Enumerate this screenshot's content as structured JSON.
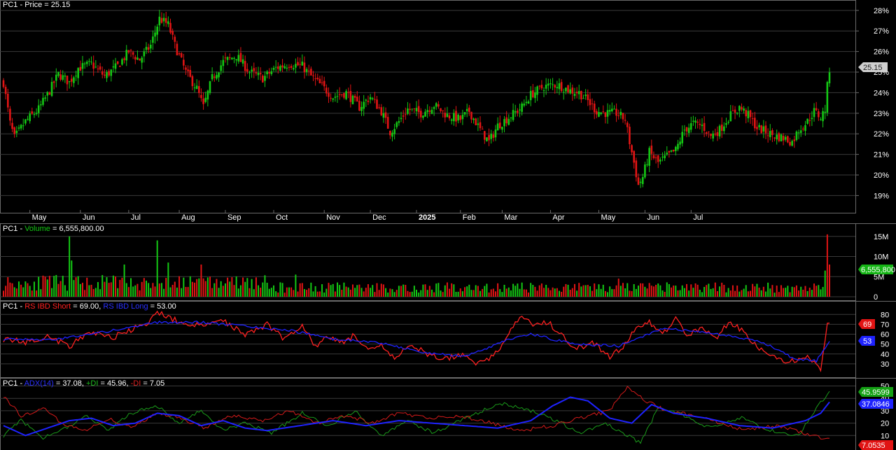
{
  "colors": {
    "up": "#14c814",
    "down": "#e11414",
    "grid": "#3a3a3a",
    "border": "#6a6a6a",
    "text": "#ffffff",
    "rs_short": "#ff2020",
    "rs_long": "#1e22ff",
    "adx": "#1e22ff",
    "plus_di": "#1a9a1a",
    "minus_di": "#d41a1a"
  },
  "price_panel": {
    "symbol": "PC1",
    "title_label": "Price = 25.15",
    "last_price": "25.15",
    "y_tick_labels": [
      "28%",
      "27%",
      "26%",
      "25%",
      "24%",
      "23%",
      "22%",
      "21%",
      "20%",
      "19%"
    ],
    "x_tick_labels": [
      "May",
      "Jun",
      "Jul",
      "Aug",
      "Sep",
      "Oct",
      "Nov",
      "Dec",
      "2025",
      "Feb",
      "Mar",
      "Apr",
      "May",
      "Jun",
      "Jul"
    ]
  },
  "volume_panel": {
    "symbol": "PC1",
    "name": "Volume",
    "value_text": "6,555,800.00",
    "last_value_label": "6,555,800",
    "y_tick_labels": [
      "15M",
      "10M",
      "5M",
      "0"
    ]
  },
  "rs_panel": {
    "symbol": "PC1",
    "short_label": "RS IBD Short",
    "short_value": "69.00",
    "long_label": "RS IBD Long",
    "long_value": "53.00",
    "short_last": "69",
    "long_last": "53",
    "y_tick_labels": [
      "80",
      "70",
      "60",
      "50",
      "40",
      "30"
    ]
  },
  "adx_panel": {
    "symbol": "PC1",
    "adx_label": "ADX(14)",
    "adx_value": "37.08",
    "plus_label": "+DI",
    "plus_value": "45.96",
    "minus_label": "-DI",
    "minus_value": "7.05",
    "plus_last": "45.9599",
    "adx_last": "37.0846",
    "minus_last": "7.0535",
    "y_tick_labels": [
      "50",
      "40",
      "30",
      "20",
      "10"
    ]
  },
  "chart_data": [
    {
      "type": "candlestick",
      "title": "PC1 - Price = 25.15",
      "ylim": [
        18.3,
        28.3
      ],
      "x_tick_labels": [
        "May",
        "Jun",
        "Jul",
        "Aug",
        "Sep",
        "Oct",
        "Nov",
        "Dec",
        "2025",
        "Feb",
        "Mar",
        "Apr",
        "May",
        "Jun",
        "Jul"
      ],
      "close_path": [
        [
          0,
          24.5
        ],
        [
          3,
          22.5
        ],
        [
          5,
          21.8
        ],
        [
          10,
          22.6
        ],
        [
          16,
          23.2
        ],
        [
          20,
          23.9
        ],
        [
          25,
          24.9
        ],
        [
          30,
          24.5
        ],
        [
          34,
          25.2
        ],
        [
          40,
          25.4
        ],
        [
          46,
          24.8
        ],
        [
          52,
          25.3
        ],
        [
          57,
          26.0
        ],
        [
          62,
          25.6
        ],
        [
          67,
          26.3
        ],
        [
          71,
          27.6
        ],
        [
          75,
          27.3
        ],
        [
          78,
          26.3
        ],
        [
          83,
          25.0
        ],
        [
          88,
          24.2
        ],
        [
          91,
          23.3
        ],
        [
          95,
          24.7
        ],
        [
          100,
          25.5
        ],
        [
          106,
          25.8
        ],
        [
          112,
          25.0
        ],
        [
          118,
          24.7
        ],
        [
          124,
          25.2
        ],
        [
          130,
          25.4
        ],
        [
          136,
          25.3
        ],
        [
          140,
          24.8
        ],
        [
          146,
          24.2
        ],
        [
          150,
          23.8
        ],
        [
          156,
          24.0
        ],
        [
          162,
          23.3
        ],
        [
          167,
          23.8
        ],
        [
          172,
          23.1
        ],
        [
          176,
          22.1
        ],
        [
          180,
          22.6
        ],
        [
          184,
          23.2
        ],
        [
          190,
          23.0
        ],
        [
          196,
          23.4
        ],
        [
          202,
          22.9
        ],
        [
          208,
          22.7
        ],
        [
          212,
          23.1
        ],
        [
          217,
          22.2
        ],
        [
          221,
          21.6
        ],
        [
          225,
          22.4
        ],
        [
          230,
          22.8
        ],
        [
          236,
          23.3
        ],
        [
          240,
          23.9
        ],
        [
          246,
          24.3
        ],
        [
          252,
          24.4
        ],
        [
          258,
          24.1
        ],
        [
          262,
          24.0
        ],
        [
          266,
          23.6
        ],
        [
          270,
          23.1
        ],
        [
          275,
          23.0
        ],
        [
          279,
          23.0
        ],
        [
          283,
          22.7
        ],
        [
          285,
          21.6
        ],
        [
          287,
          20.6
        ],
        [
          289,
          19.5
        ],
        [
          291,
          19.9
        ],
        [
          294,
          21.1
        ],
        [
          298,
          20.6
        ],
        [
          302,
          20.9
        ],
        [
          306,
          21.2
        ],
        [
          310,
          22.2
        ],
        [
          314,
          22.5
        ],
        [
          318,
          22.4
        ],
        [
          322,
          21.9
        ],
        [
          326,
          22.2
        ],
        [
          330,
          22.8
        ],
        [
          335,
          23.3
        ],
        [
          339,
          22.9
        ],
        [
          343,
          22.3
        ],
        [
          347,
          22.1
        ],
        [
          351,
          21.9
        ],
        [
          355,
          21.8
        ],
        [
          359,
          21.6
        ],
        [
          362,
          22.2
        ],
        [
          366,
          22.6
        ],
        [
          369,
          23.1
        ],
        [
          372,
          22.8
        ],
        [
          374,
          23.2
        ],
        [
          375,
          24.3
        ],
        [
          376,
          25.15
        ]
      ]
    },
    {
      "type": "bar",
      "title": "PC1 - Volume = 6,555,800.00",
      "ylim": [
        0,
        16000000
      ],
      "typical_volume": 2000000,
      "spikes": [
        [
          30,
          15000000
        ],
        [
          31,
          9000000
        ],
        [
          70,
          14000000
        ],
        [
          55,
          8000000
        ],
        [
          75,
          8500000
        ],
        [
          90,
          8000000
        ],
        [
          133,
          5500000
        ],
        [
          280,
          4500000
        ],
        [
          375,
          15500000
        ],
        [
          376,
          8000000
        ],
        [
          374,
          6500000
        ]
      ]
    },
    {
      "type": "line",
      "title": "PC1 - RS IBD Short = 69.00, RS IBD Long = 53.00",
      "ylim": [
        20,
        88
      ],
      "series": [
        {
          "name": "RS IBD Short",
          "path": [
            [
              0,
              55
            ],
            [
              10,
              52
            ],
            [
              20,
              58
            ],
            [
              30,
              48
            ],
            [
              40,
              62
            ],
            [
              50,
              57
            ],
            [
              60,
              66
            ],
            [
              66,
              70
            ],
            [
              70,
              83
            ],
            [
              80,
              72
            ],
            [
              90,
              68
            ],
            [
              100,
              74
            ],
            [
              110,
              60
            ],
            [
              120,
              70
            ],
            [
              128,
              55
            ],
            [
              136,
              70
            ],
            [
              142,
              48
            ],
            [
              148,
              57
            ],
            [
              155,
              52
            ],
            [
              160,
              60
            ],
            [
              166,
              42
            ],
            [
              172,
              48
            ],
            [
              178,
              35
            ],
            [
              186,
              50
            ],
            [
              194,
              38
            ],
            [
              200,
              35
            ],
            [
              210,
              40
            ],
            [
              216,
              30
            ],
            [
              224,
              40
            ],
            [
              230,
              62
            ],
            [
              236,
              78
            ],
            [
              242,
              68
            ],
            [
              248,
              72
            ],
            [
              254,
              60
            ],
            [
              260,
              44
            ],
            [
              268,
              52
            ],
            [
              276,
              36
            ],
            [
              282,
              48
            ],
            [
              288,
              66
            ],
            [
              294,
              72
            ],
            [
              300,
              60
            ],
            [
              306,
              76
            ],
            [
              312,
              58
            ],
            [
              318,
              69
            ],
            [
              324,
              55
            ],
            [
              330,
              72
            ],
            [
              336,
              64
            ],
            [
              342,
              50
            ],
            [
              348,
              38
            ],
            [
              354,
              34
            ],
            [
              360,
              32
            ],
            [
              366,
              38
            ],
            [
              372,
              25
            ],
            [
              375,
              69
            ],
            [
              376,
              69
            ]
          ]
        },
        {
          "name": "RS IBD Long",
          "path": [
            [
              0,
              55
            ],
            [
              20,
              54
            ],
            [
              40,
              60
            ],
            [
              60,
              68
            ],
            [
              70,
              72
            ],
            [
              90,
              72
            ],
            [
              110,
              68
            ],
            [
              130,
              64
            ],
            [
              150,
              55
            ],
            [
              170,
              52
            ],
            [
              190,
              42
            ],
            [
              210,
              37
            ],
            [
              230,
              55
            ],
            [
              240,
              60
            ],
            [
              260,
              50
            ],
            [
              280,
              48
            ],
            [
              300,
              66
            ],
            [
              320,
              62
            ],
            [
              340,
              55
            ],
            [
              350,
              47
            ],
            [
              360,
              35
            ],
            [
              370,
              33
            ],
            [
              376,
              53
            ]
          ]
        }
      ]
    },
    {
      "type": "line",
      "title": "PC1 - ADX(14) = 37.08, +DI = 45.96, -DI = 7.05",
      "ylim": [
        0,
        52
      ],
      "series": [
        {
          "name": "ADX(14)",
          "path": [
            [
              0,
              18
            ],
            [
              10,
              10
            ],
            [
              20,
              16
            ],
            [
              30,
              22
            ],
            [
              40,
              24
            ],
            [
              50,
              18
            ],
            [
              60,
              20
            ],
            [
              70,
              28
            ],
            [
              80,
              26
            ],
            [
              90,
              18
            ],
            [
              100,
              22
            ],
            [
              110,
              16
            ],
            [
              120,
              14
            ],
            [
              135,
              18
            ],
            [
              150,
              22
            ],
            [
              165,
              18
            ],
            [
              180,
              22
            ],
            [
              195,
              20
            ],
            [
              210,
              18
            ],
            [
              225,
              16
            ],
            [
              240,
              22
            ],
            [
              250,
              34
            ],
            [
              258,
              41
            ],
            [
              266,
              38
            ],
            [
              276,
              24
            ],
            [
              286,
              20
            ],
            [
              295,
              35
            ],
            [
              305,
              28
            ],
            [
              320,
              24
            ],
            [
              335,
              18
            ],
            [
              350,
              16
            ],
            [
              365,
              22
            ],
            [
              372,
              28
            ],
            [
              376,
              37
            ]
          ]
        },
        {
          "name": "+DI",
          "path": [
            [
              0,
              10
            ],
            [
              8,
              22
            ],
            [
              18,
              8
            ],
            [
              28,
              16
            ],
            [
              38,
              26
            ],
            [
              48,
              14
            ],
            [
              58,
              28
            ],
            [
              70,
              34
            ],
            [
              80,
              20
            ],
            [
              90,
              30
            ],
            [
              100,
              14
            ],
            [
              110,
              20
            ],
            [
              122,
              12
            ],
            [
              136,
              28
            ],
            [
              148,
              18
            ],
            [
              160,
              30
            ],
            [
              172,
              10
            ],
            [
              184,
              22
            ],
            [
              196,
              12
            ],
            [
              210,
              24
            ],
            [
              226,
              36
            ],
            [
              240,
              30
            ],
            [
              252,
              22
            ],
            [
              262,
              12
            ],
            [
              274,
              20
            ],
            [
              284,
              10
            ],
            [
              290,
              4
            ],
            [
              298,
              32
            ],
            [
              310,
              26
            ],
            [
              322,
              16
            ],
            [
              336,
              24
            ],
            [
              350,
              14
            ],
            [
              362,
              10
            ],
            [
              370,
              32
            ],
            [
              376,
              46
            ]
          ]
        },
        {
          "name": "-DI",
          "path": [
            [
              0,
              42
            ],
            [
              8,
              26
            ],
            [
              18,
              32
            ],
            [
              28,
              18
            ],
            [
              38,
              14
            ],
            [
              48,
              24
            ],
            [
              58,
              16
            ],
            [
              70,
              28
            ],
            [
              80,
              24
            ],
            [
              92,
              16
            ],
            [
              104,
              26
            ],
            [
              118,
              22
            ],
            [
              130,
              30
            ],
            [
              142,
              20
            ],
            [
              156,
              26
            ],
            [
              168,
              20
            ],
            [
              180,
              28
            ],
            [
              194,
              24
            ],
            [
              208,
              26
            ],
            [
              222,
              20
            ],
            [
              236,
              14
            ],
            [
              250,
              18
            ],
            [
              262,
              24
            ],
            [
              276,
              30
            ],
            [
              284,
              50
            ],
            [
              292,
              38
            ],
            [
              302,
              30
            ],
            [
              314,
              26
            ],
            [
              326,
              20
            ],
            [
              338,
              14
            ],
            [
              352,
              18
            ],
            [
              364,
              12
            ],
            [
              372,
              8
            ],
            [
              376,
              7
            ]
          ]
        }
      ]
    }
  ]
}
